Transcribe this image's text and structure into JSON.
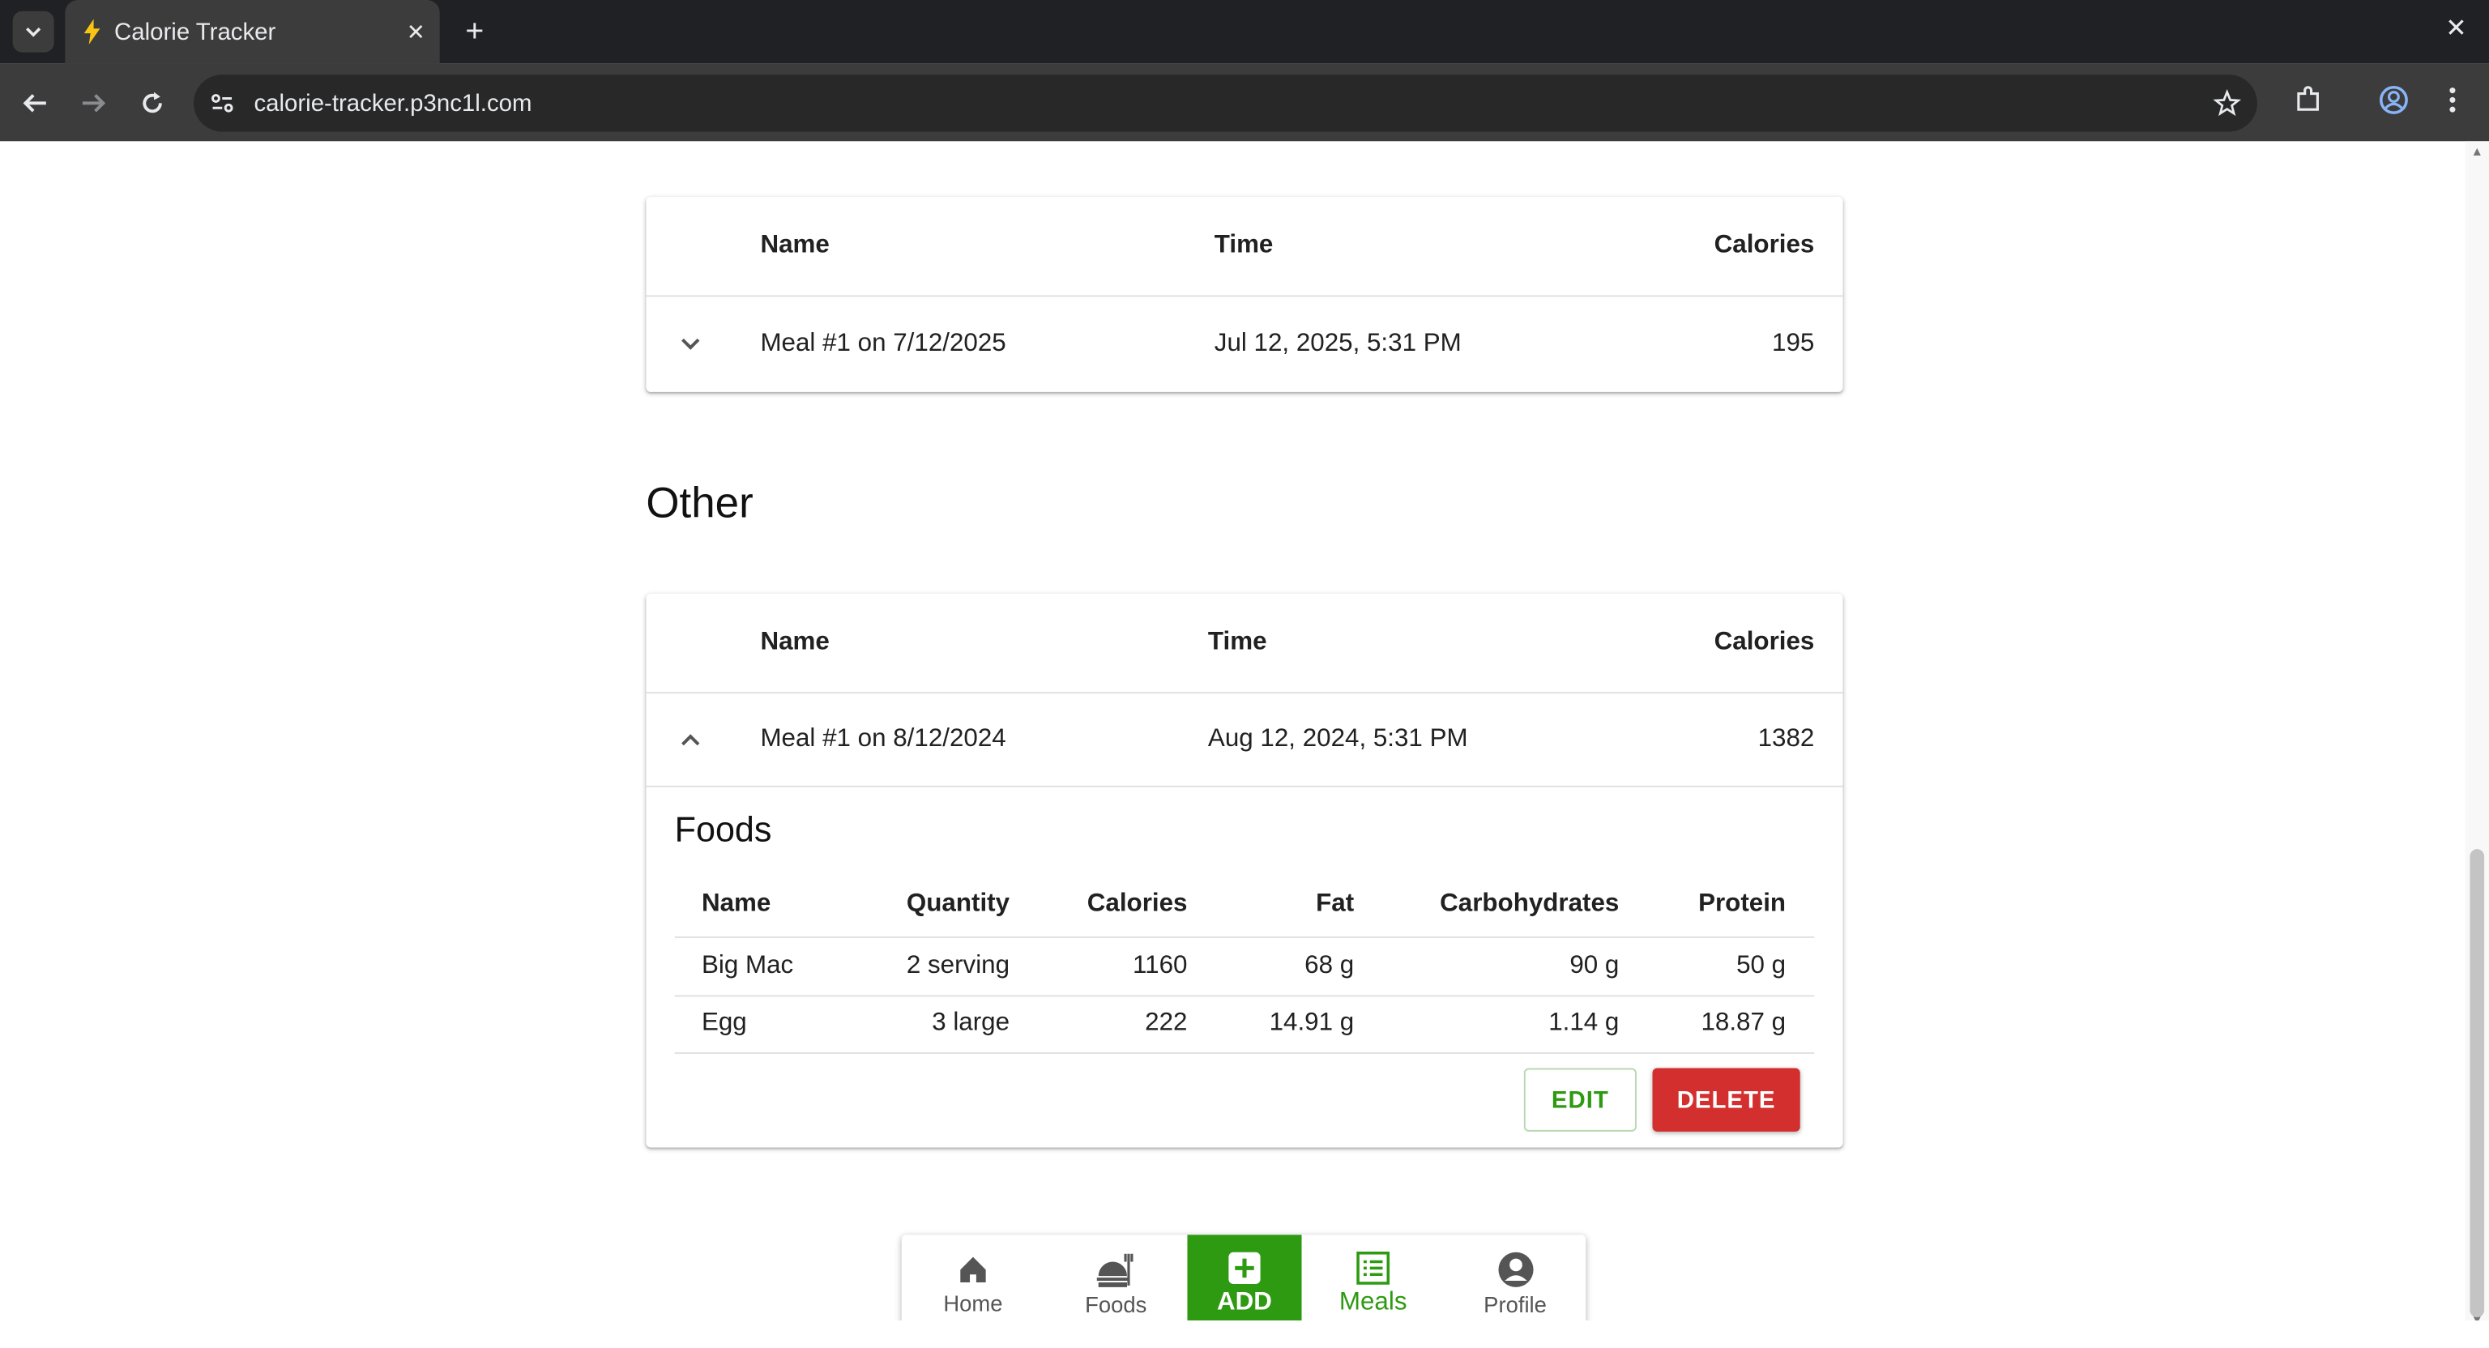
{
  "browser": {
    "tab_title": "Calorie Tracker",
    "url": "calorie-tracker.p3nc1l.com"
  },
  "first_card": {
    "headers": {
      "name": "Name",
      "time": "Time",
      "calories": "Calories"
    },
    "meal": {
      "name": "Meal #1 on 7/12/2025",
      "time": "Jul 12, 2025, 5:31 PM",
      "calories": "195"
    }
  },
  "other_section": {
    "title": "Other",
    "headers": {
      "name": "Name",
      "time": "Time",
      "calories": "Calories"
    },
    "meal": {
      "name": "Meal #1 on 8/12/2024",
      "time": "Aug 12, 2024, 5:31 PM",
      "calories": "1382"
    },
    "foods": {
      "title": "Foods",
      "columns": [
        "Name",
        "Quantity",
        "Calories",
        "Fat",
        "Carbohydrates",
        "Protein"
      ],
      "rows": [
        [
          "Big Mac",
          "2 serving",
          "1160",
          "68 g",
          "90 g",
          "50 g"
        ],
        [
          "Egg",
          "3 large",
          "222",
          "14.91 g",
          "1.14 g",
          "18.87 g"
        ]
      ]
    },
    "edit_label": "EDIT",
    "delete_label": "DELETE"
  },
  "bottom_nav": {
    "home": "Home",
    "foods": "Foods",
    "add": "ADD",
    "meals": "Meals",
    "profile": "Profile"
  },
  "colors": {
    "accent": "#2e9a12",
    "danger": "#d32f2f"
  }
}
